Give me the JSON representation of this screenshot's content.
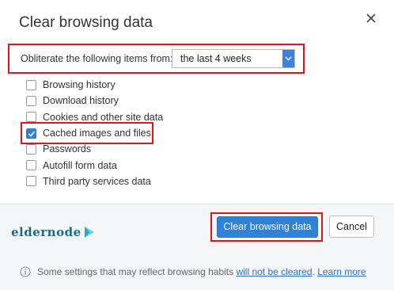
{
  "dialog": {
    "title": "Clear browsing data",
    "close_icon": "close-icon"
  },
  "time_range": {
    "label": "Obliterate the following items from:",
    "selected": "the last 4 weeks"
  },
  "options": [
    {
      "label": "Browsing history",
      "checked": false
    },
    {
      "label": "Download history",
      "checked": false
    },
    {
      "label": "Cookies and other site data",
      "checked": false
    },
    {
      "label": "Cached images and files",
      "checked": true
    },
    {
      "label": "Passwords",
      "checked": false
    },
    {
      "label": "Autofill form data",
      "checked": false
    },
    {
      "label": "Third party services data",
      "checked": false
    }
  ],
  "footer": {
    "logo_text": "eldernode",
    "clear_button": "Clear browsing data",
    "cancel_button": "Cancel",
    "notice_text": "Some settings that may reflect browsing habits ",
    "notice_link": "will not be cleared",
    "notice_sep": ". ",
    "learn_more": "Learn more"
  },
  "colors": {
    "accent": "#2f82d8",
    "highlight": "#e0161e",
    "logo": "#1a6b8a"
  }
}
